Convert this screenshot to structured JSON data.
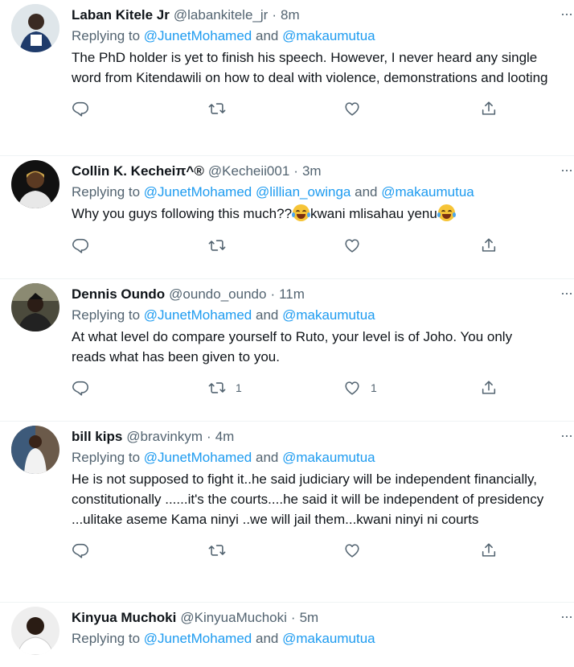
{
  "tweets": [
    {
      "name": "Laban Kitele Jr",
      "handle": "@labankitele_jr",
      "time": "8m",
      "reply_prefix": "Replying to",
      "mentions": [
        "@JunetMohamed",
        "@makaumutua"
      ],
      "text": "The PhD holder is yet to finish his speech. However, I never heard any single word from Kitendawili on how to deal with violence, demonstrations and looting",
      "replies": "",
      "retweets": "",
      "likes": ""
    },
    {
      "name": "Collin K. Kecheiπ^®",
      "handle": "@Kecheii001",
      "time": "3m",
      "reply_prefix": "Replying to",
      "mentions": [
        "@JunetMohamed",
        "@lillian_owinga",
        "@makaumutua"
      ],
      "text_parts": [
        "Why you guys following this much??",
        "kwani mlisahau yenu"
      ],
      "replies": "",
      "retweets": "",
      "likes": ""
    },
    {
      "name": "Dennis Oundo",
      "handle": "@oundo_oundo",
      "time": "11m",
      "reply_prefix": "Replying to",
      "mentions": [
        "@JunetMohamed",
        "@makaumutua"
      ],
      "text": "At what level do compare yourself to Ruto, your level is of Joho. You only reads what has been given to you.",
      "replies": "",
      "retweets": "1",
      "likes": "1"
    },
    {
      "name": "bill kips",
      "handle": "@bravinkym",
      "time": "4m",
      "reply_prefix": "Replying to",
      "mentions": [
        "@JunetMohamed",
        "@makaumutua"
      ],
      "text": "He is not supposed to fight it..he said judiciary will be independent financially, constitutionally ......it's the courts....he said it will be independent of presidency ...ulitake aseme Kama ninyi ..we will jail them...kwani ninyi ni courts",
      "replies": "",
      "retweets": "",
      "likes": ""
    },
    {
      "name": "Kinyua Muchoki",
      "handle": "@KinyuaMuchoki",
      "time": "5m",
      "reply_prefix": "Replying to",
      "mentions": [
        "@JunetMohamed",
        "@makaumutua"
      ]
    }
  ],
  "separators": {
    "dot": "·",
    "and": "and",
    "more": "···"
  },
  "colors": {
    "link": "#1d9bf0",
    "muted": "#536471",
    "text": "#0f1419",
    "border": "#eff3f4"
  },
  "icons": [
    "reply-icon",
    "retweet-icon",
    "like-icon",
    "share-icon",
    "more-icon"
  ]
}
